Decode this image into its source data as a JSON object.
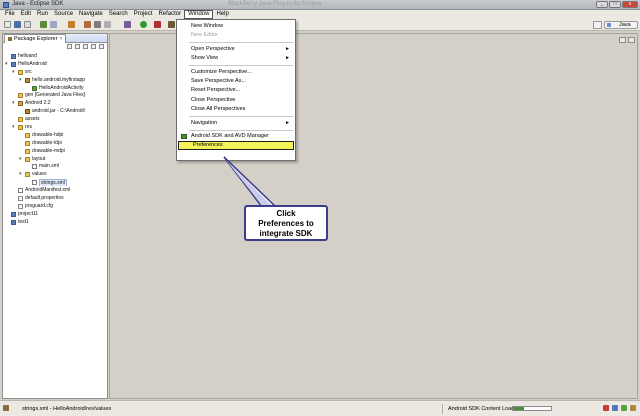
{
  "window": {
    "title": "Java - Eclipse SDK",
    "ghost_title": "BlackBerry Java Plug-in for Eclipse"
  },
  "menubar": [
    "File",
    "Edit",
    "Run",
    "Source",
    "Navigate",
    "Search",
    "Project",
    "Refactor",
    "Window",
    "Help"
  ],
  "perspective": {
    "label": "Java"
  },
  "explorer": {
    "tab_label": "Package Explorer",
    "tree": [
      {
        "label": "helloand",
        "indent": 0,
        "icon": "proj"
      },
      {
        "label": "HelloAndroid",
        "indent": 0,
        "icon": "proj",
        "open": true
      },
      {
        "label": "src",
        "indent": 1,
        "icon": "folder",
        "open": true
      },
      {
        "label": "hello.android.myfirstapp",
        "indent": 2,
        "icon": "pkg",
        "open": true
      },
      {
        "label": "HelloAndroidActivity",
        "indent": 3,
        "icon": "java"
      },
      {
        "label": "gen [Generated Java Files]",
        "indent": 1,
        "icon": "folder"
      },
      {
        "label": "Android 2.2",
        "indent": 1,
        "icon": "lib",
        "open": true
      },
      {
        "label": "android.jar - C:\\Android\\",
        "indent": 2,
        "icon": "jar"
      },
      {
        "label": "assets",
        "indent": 1,
        "icon": "folder"
      },
      {
        "label": "res",
        "indent": 1,
        "icon": "folder",
        "open": true
      },
      {
        "label": "drawable-hdpi",
        "indent": 2,
        "icon": "folder"
      },
      {
        "label": "drawable-ldpi",
        "indent": 2,
        "icon": "folder"
      },
      {
        "label": "drawable-mdpi",
        "indent": 2,
        "icon": "folder"
      },
      {
        "label": "layout",
        "indent": 2,
        "icon": "folder",
        "open": true
      },
      {
        "label": "main.xml",
        "indent": 3,
        "icon": "xml"
      },
      {
        "label": "values",
        "indent": 2,
        "icon": "folder",
        "open": true
      },
      {
        "label": "strings.xml",
        "indent": 3,
        "icon": "xml",
        "selected": true
      },
      {
        "label": "AndroidManifest.xml",
        "indent": 1,
        "icon": "xml"
      },
      {
        "label": "default.properties",
        "indent": 1,
        "icon": "file"
      },
      {
        "label": "proguard.cfg",
        "indent": 1,
        "icon": "file"
      },
      {
        "label": "project11",
        "indent": 0,
        "icon": "proj"
      },
      {
        "label": "test1",
        "indent": 0,
        "icon": "proj"
      }
    ]
  },
  "window_menu": {
    "items": [
      {
        "label": "New Window",
        "disabled": false
      },
      {
        "label": "New Editor",
        "disabled": true
      },
      {
        "sep": true
      },
      {
        "label": "Open Perspective",
        "submenu": true
      },
      {
        "label": "Show View",
        "submenu": true
      },
      {
        "sep": true
      },
      {
        "label": "Customize Perspective..."
      },
      {
        "label": "Save Perspective As..."
      },
      {
        "label": "Reset Perspective..."
      },
      {
        "label": "Close Perspective"
      },
      {
        "label": "Close All Perspectives"
      },
      {
        "sep": true
      },
      {
        "label": "Navigation",
        "submenu": true
      },
      {
        "sep": true
      },
      {
        "label": "Android SDK and AVD Manager",
        "icon": "android-icon"
      },
      {
        "label": "Preferences",
        "highlighted": true
      }
    ]
  },
  "callout": {
    "line1": "Click",
    "line2": "Preferences to",
    "line3": "integrate SDK"
  },
  "statusbar": {
    "left_text": "strings.xml - HelloAndroid/res/values",
    "right_text": "Android SDK Content Loader"
  },
  "colors": {
    "highlight": "#f3f35a",
    "callout_border": "#3a3c8c"
  }
}
